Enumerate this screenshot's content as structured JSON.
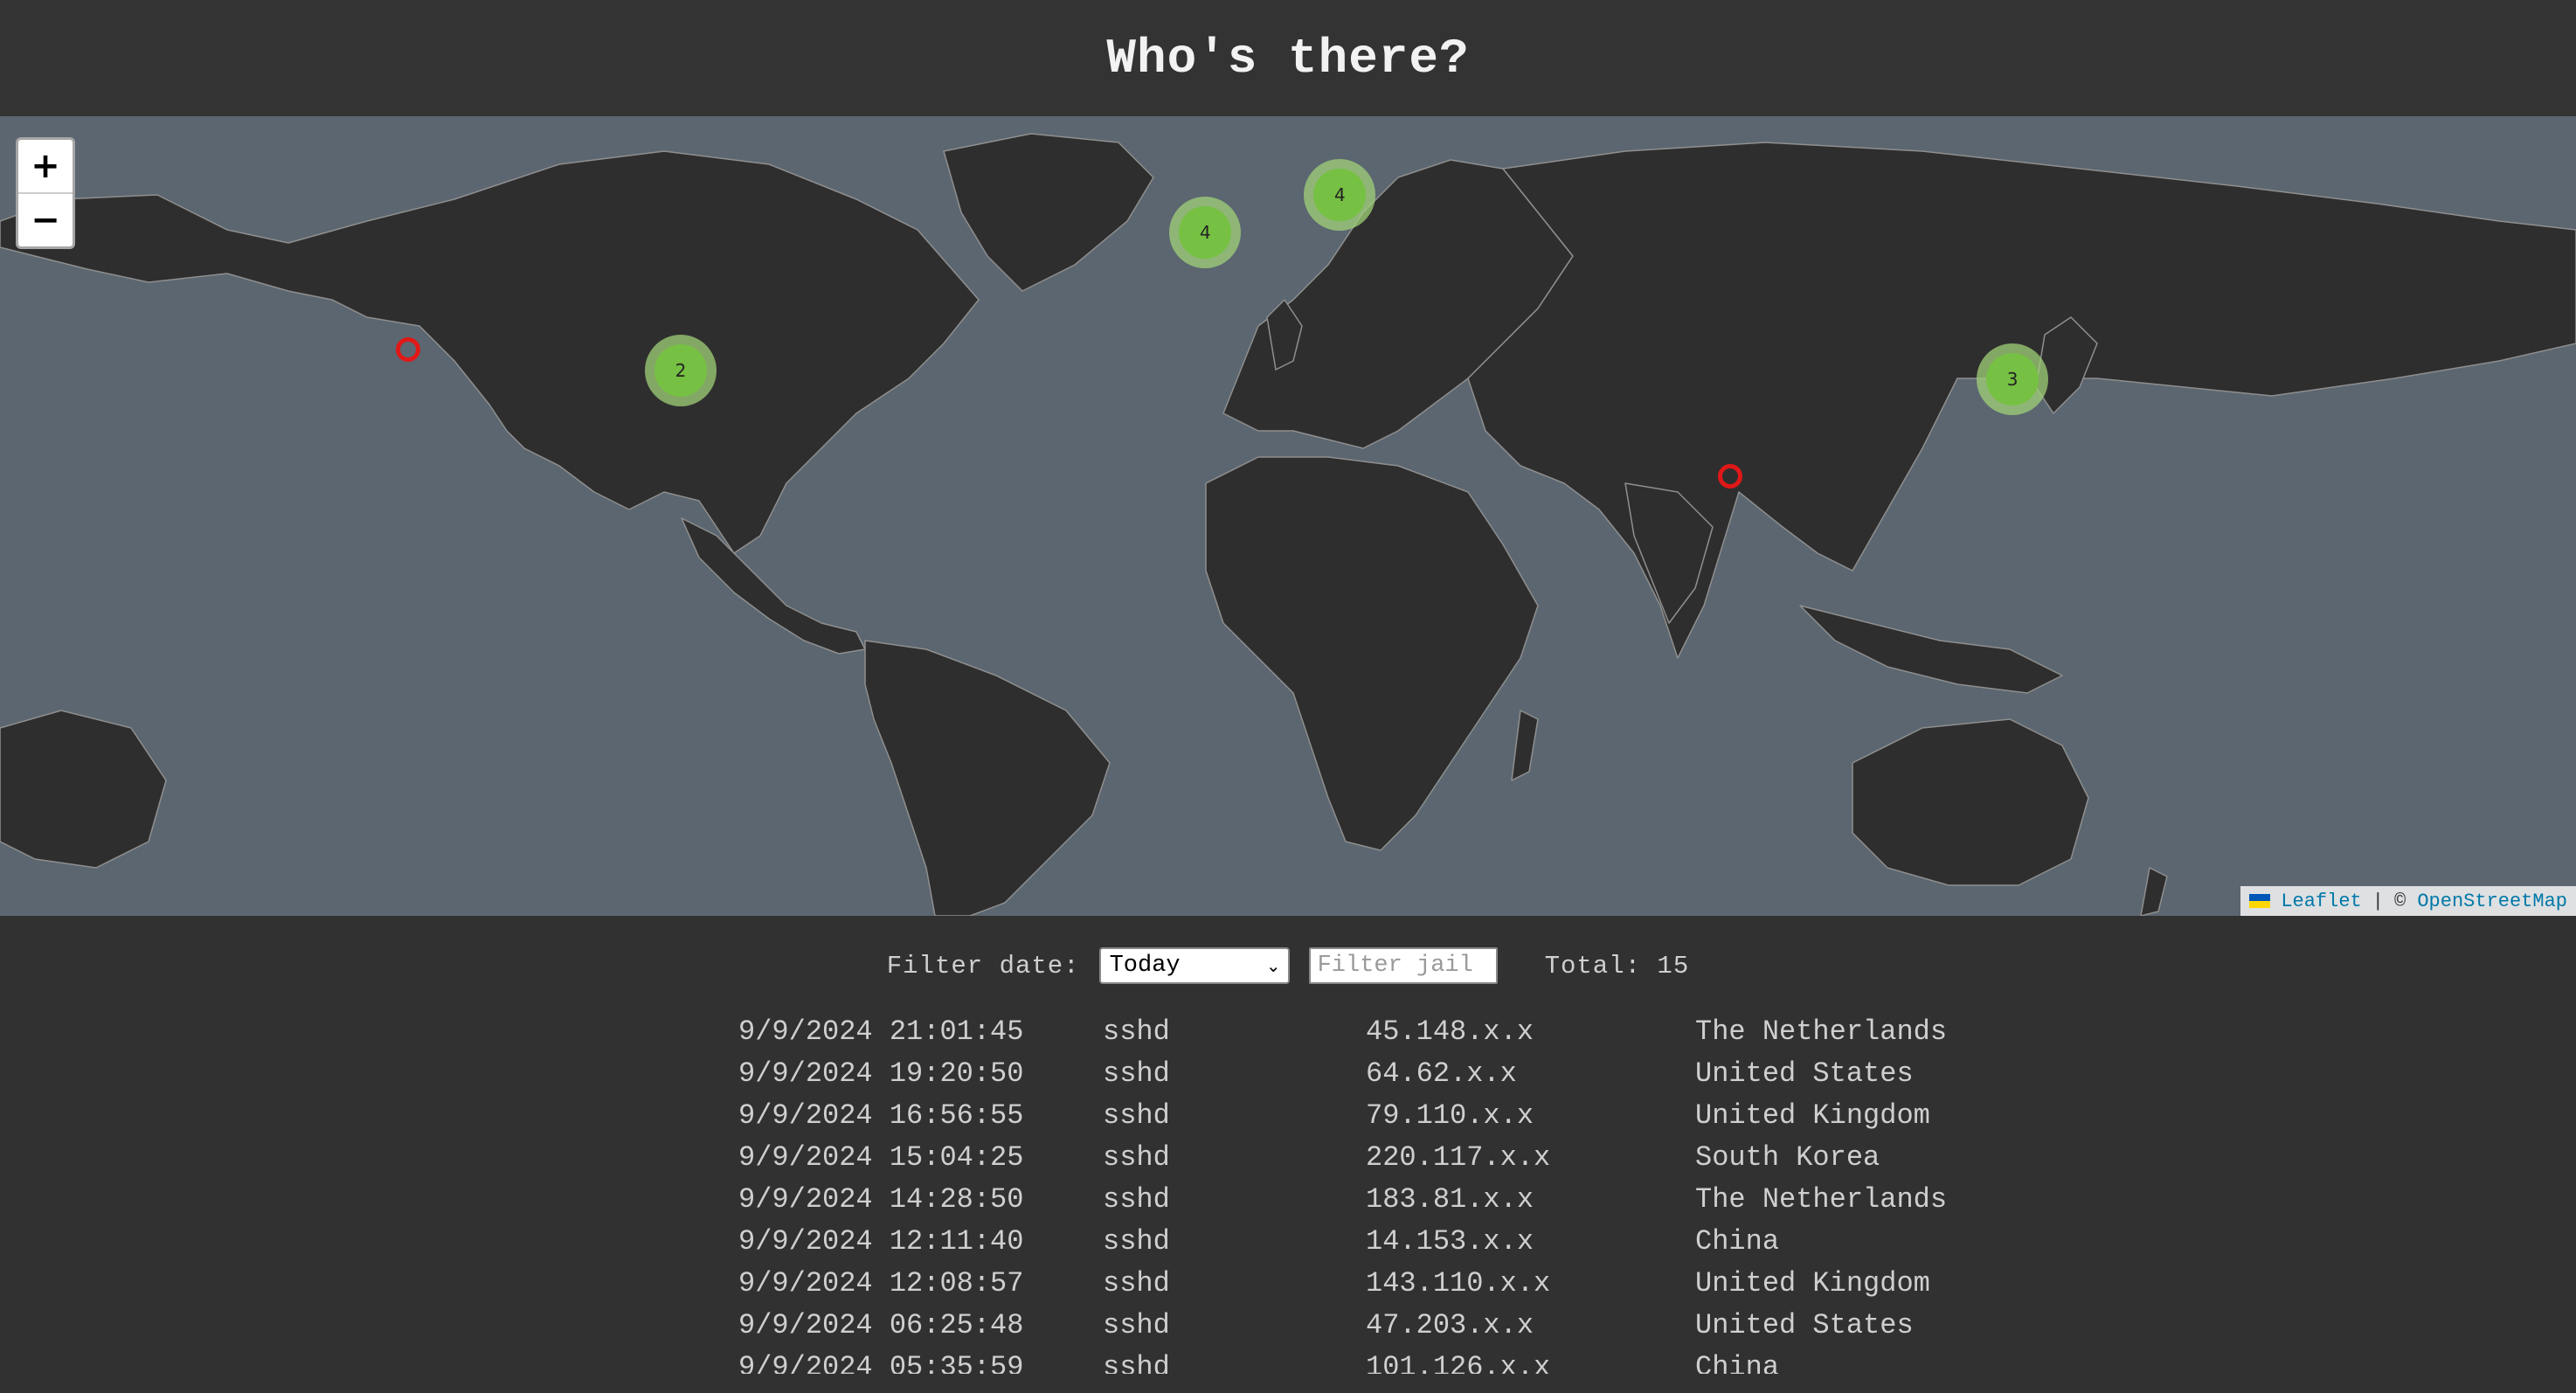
{
  "header": {
    "title": "Who's there?"
  },
  "map": {
    "zoom_in": "+",
    "zoom_out": "−",
    "clusters": [
      {
        "name": "north-america-east",
        "count": "2",
        "lat": 30.5,
        "lon": -77.5
      },
      {
        "name": "western-europe",
        "count": "4",
        "lat": 51.0,
        "lon": 0.5
      },
      {
        "name": "eastern-europe",
        "count": "4",
        "lat": 55.5,
        "lon": 20.5
      },
      {
        "name": "east-asia",
        "count": "3",
        "lat": 29.0,
        "lon": 120.5
      }
    ],
    "markers": [
      {
        "name": "california",
        "lat": 34.0,
        "lon": -118.0
      },
      {
        "name": "south-india",
        "lat": 11.0,
        "lon": 78.5
      }
    ],
    "attribution": {
      "leaflet": "Leaflet",
      "separator": "|",
      "copyright": "©",
      "osm": "OpenStreetMap"
    },
    "colors": {
      "water": "#5b6670",
      "land": "#2f2e2e",
      "border": "#8f8f8f",
      "cluster": "#76c043",
      "marker": "#e01818"
    }
  },
  "filters": {
    "date_label": "Filter date:",
    "date_value": "Today",
    "jail_placeholder": "Filter jail",
    "total_label": "Total: 15"
  },
  "entries": [
    {
      "date": "9/9/2024 21:01:45",
      "jail": "sshd",
      "ip": "45.148.x.x",
      "country": "The Netherlands"
    },
    {
      "date": "9/9/2024 19:20:50",
      "jail": "sshd",
      "ip": "64.62.x.x",
      "country": "United States"
    },
    {
      "date": "9/9/2024 16:56:55",
      "jail": "sshd",
      "ip": "79.110.x.x",
      "country": "United Kingdom"
    },
    {
      "date": "9/9/2024 15:04:25",
      "jail": "sshd",
      "ip": "220.117.x.x",
      "country": "South Korea"
    },
    {
      "date": "9/9/2024 14:28:50",
      "jail": "sshd",
      "ip": "183.81.x.x",
      "country": "The Netherlands"
    },
    {
      "date": "9/9/2024 12:11:40",
      "jail": "sshd",
      "ip": "14.153.x.x",
      "country": "China"
    },
    {
      "date": "9/9/2024 12:08:57",
      "jail": "sshd",
      "ip": "143.110.x.x",
      "country": "United Kingdom"
    },
    {
      "date": "9/9/2024 06:25:48",
      "jail": "sshd",
      "ip": "47.203.x.x",
      "country": "United States"
    },
    {
      "date": "9/9/2024 05:35:59",
      "jail": "sshd",
      "ip": "101.126.x.x",
      "country": "China"
    }
  ]
}
